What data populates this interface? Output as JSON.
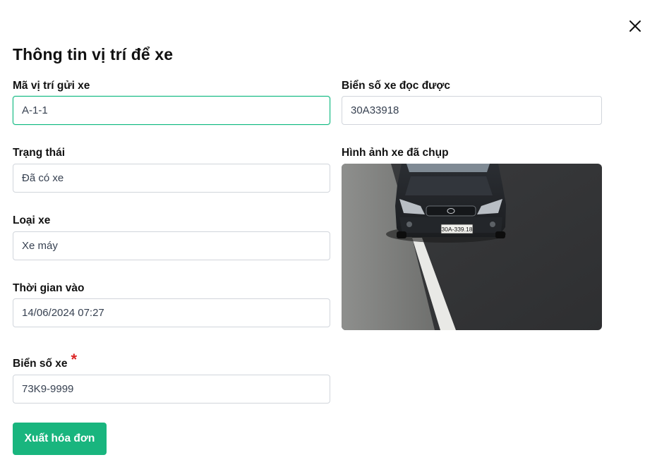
{
  "dialog": {
    "title": "Thông tin vị trí để xe",
    "close_icon": "close-icon"
  },
  "fields": {
    "slot_code": {
      "label": "Mã vị trí gửi xe",
      "value": "A-1-1"
    },
    "status": {
      "label": "Trạng thái",
      "value": "Đã có xe"
    },
    "vehicle_type": {
      "label": "Loại xe",
      "value": "Xe máy"
    },
    "time_in": {
      "label": "Thời gian vào",
      "value": "14/06/2024 07:27"
    },
    "plate": {
      "label": "Biển số xe",
      "required_mark": "*",
      "value": "73K9-9999"
    },
    "plate_read": {
      "label": "Biển số xe đọc được",
      "value": "30A33918"
    },
    "captured_image": {
      "label": "Hình ảnh xe đã chụp",
      "plate_text": "30A-339.18"
    }
  },
  "actions": {
    "invoice_label": "Xuất hóa đơn"
  },
  "colors": {
    "accent": "#19b57e",
    "focus_border": "#10b981",
    "required": "#dc2626"
  }
}
